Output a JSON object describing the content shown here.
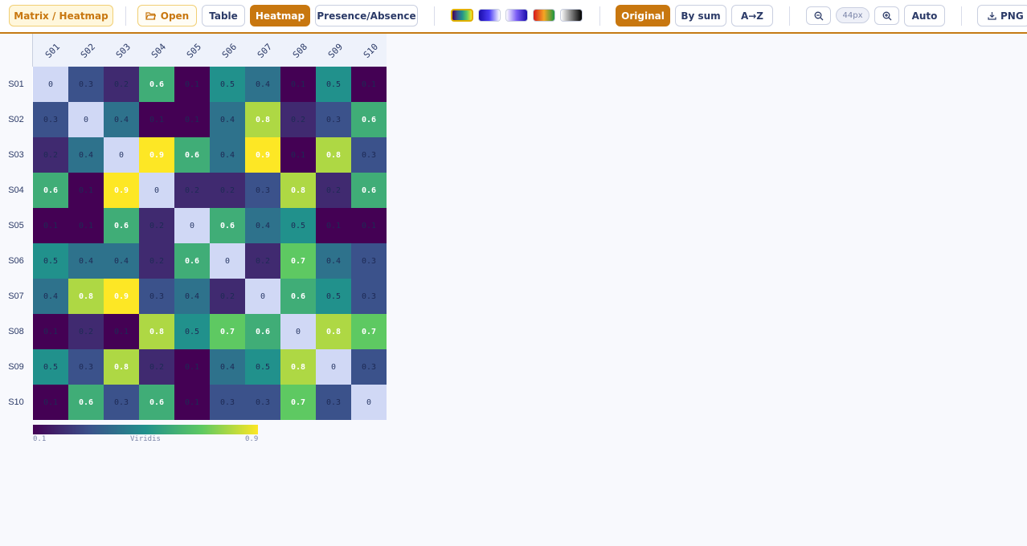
{
  "toolbar": {
    "app_title": "Matrix / Heatmap",
    "open_label": "Open",
    "view_tabs": [
      "Table",
      "Heatmap",
      "Presence/Absence"
    ],
    "active_view": "Heatmap",
    "palettes": [
      "viridis",
      "blues",
      "purple-white",
      "red-green",
      "grayscale"
    ],
    "active_palette": "viridis",
    "sort_options": [
      "Original",
      "By sum",
      "A→Z"
    ],
    "active_sort": "Original",
    "cell_size": "44px",
    "auto_label": "Auto",
    "export_label": "PNG"
  },
  "matrix": {
    "labels": [
      "S01",
      "S02",
      "S03",
      "S04",
      "S05",
      "S06",
      "S07",
      "S08",
      "S09",
      "S10"
    ],
    "values": [
      [
        0,
        0.3,
        0.2,
        0.6,
        0.1,
        0.5,
        0.4,
        0.1,
        0.5,
        0.1
      ],
      [
        0.3,
        0,
        0.4,
        0.1,
        0.1,
        0.4,
        0.8,
        0.2,
        0.3,
        0.6
      ],
      [
        0.2,
        0.4,
        0,
        0.9,
        0.6,
        0.4,
        0.9,
        0.1,
        0.8,
        0.3
      ],
      [
        0.6,
        0.1,
        0.9,
        0,
        0.2,
        0.2,
        0.3,
        0.8,
        0.2,
        0.6
      ],
      [
        0.1,
        0.1,
        0.6,
        0.2,
        0,
        0.6,
        0.4,
        0.5,
        0.1,
        0.1
      ],
      [
        0.5,
        0.4,
        0.4,
        0.2,
        0.6,
        0,
        0.2,
        0.7,
        0.4,
        0.3
      ],
      [
        0.4,
        0.8,
        0.9,
        0.3,
        0.4,
        0.2,
        0,
        0.6,
        0.5,
        0.3
      ],
      [
        0.1,
        0.2,
        0.1,
        0.8,
        0.5,
        0.7,
        0.6,
        0,
        0.8,
        0.7
      ],
      [
        0.5,
        0.3,
        0.8,
        0.2,
        0.1,
        0.4,
        0.5,
        0.8,
        0,
        0.3
      ],
      [
        0.1,
        0.6,
        0.3,
        0.6,
        0.1,
        0.3,
        0.3,
        0.7,
        0.3,
        0
      ]
    ],
    "diagonal_color": "#d0d8f5"
  },
  "legend": {
    "min_label": "0.1",
    "max_label": "0.9",
    "palette_name": "Viridis",
    "min": 0.1,
    "max": 0.9
  },
  "colors": {
    "accent": "#c8770f",
    "text": "#2b3a67"
  }
}
